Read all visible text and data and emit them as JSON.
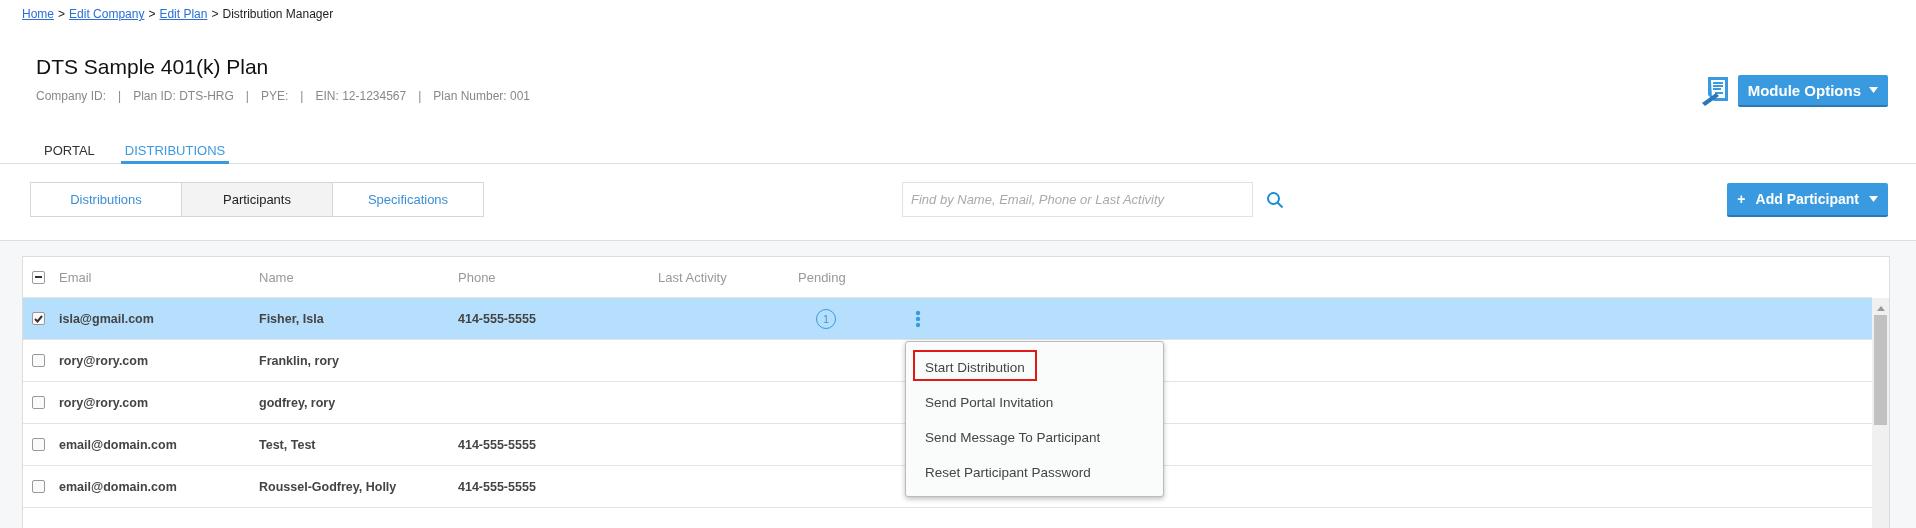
{
  "breadcrumb": {
    "links": [
      "Home",
      "Edit Company",
      "Edit Plan"
    ],
    "separator": ">",
    "current": "Distribution Manager"
  },
  "plan": {
    "title": "DTS Sample 401(k) Plan",
    "meta": [
      "Company ID:",
      "Plan ID: DTS-HRG",
      "PYE:",
      "EIN: 12-1234567",
      "Plan Number: 001"
    ],
    "meta_separator": "|"
  },
  "module_button": {
    "label": "Module Options"
  },
  "main_tabs": [
    {
      "label": "PORTAL",
      "selected": false
    },
    {
      "label": "DISTRIBUTIONS",
      "selected": true
    }
  ],
  "view_tabs": [
    {
      "label": "Distributions",
      "selected": false
    },
    {
      "label": "Participants",
      "selected": true
    },
    {
      "label": "Specifications",
      "selected": false
    }
  ],
  "search": {
    "placeholder": "Find by Name, Email, Phone or Last Activity"
  },
  "add_button": {
    "icon": "+",
    "label": "Add Participant"
  },
  "table": {
    "some_checked": true,
    "columns": [
      "Email",
      "Name",
      "Phone",
      "Last Activity",
      "Pending"
    ],
    "rows": [
      {
        "email": "isla@gmail.com",
        "name": "Fisher, Isla",
        "phone": "414-555-5555",
        "pending": "1",
        "checked": true,
        "selected": true,
        "menu": {
          "items": [
            {
              "label": "Start Distribution",
              "marked": true
            },
            {
              "label": "Send Portal Invitation",
              "marked": false
            },
            {
              "label": "Send Message To Participant",
              "marked": false
            },
            {
              "label": "Reset Participant Password",
              "marked": false
            }
          ]
        }
      },
      {
        "email": "rory@rory.com",
        "name": "Franklin, rory",
        "phone": "",
        "pending": "",
        "checked": false,
        "selected": false
      },
      {
        "email": "rory@rory.com",
        "name": "godfrey, rory",
        "phone": "",
        "pending": "",
        "checked": false,
        "selected": false
      },
      {
        "email": "email@domain.com",
        "name": "Test, Test",
        "phone": "414-555-5555",
        "pending": "",
        "checked": false,
        "selected": false
      },
      {
        "email": "email@domain.com",
        "name": "Roussel-Godfrey, Holly",
        "phone": "414-555-5555",
        "pending": "",
        "checked": false,
        "selected": false
      }
    ]
  }
}
